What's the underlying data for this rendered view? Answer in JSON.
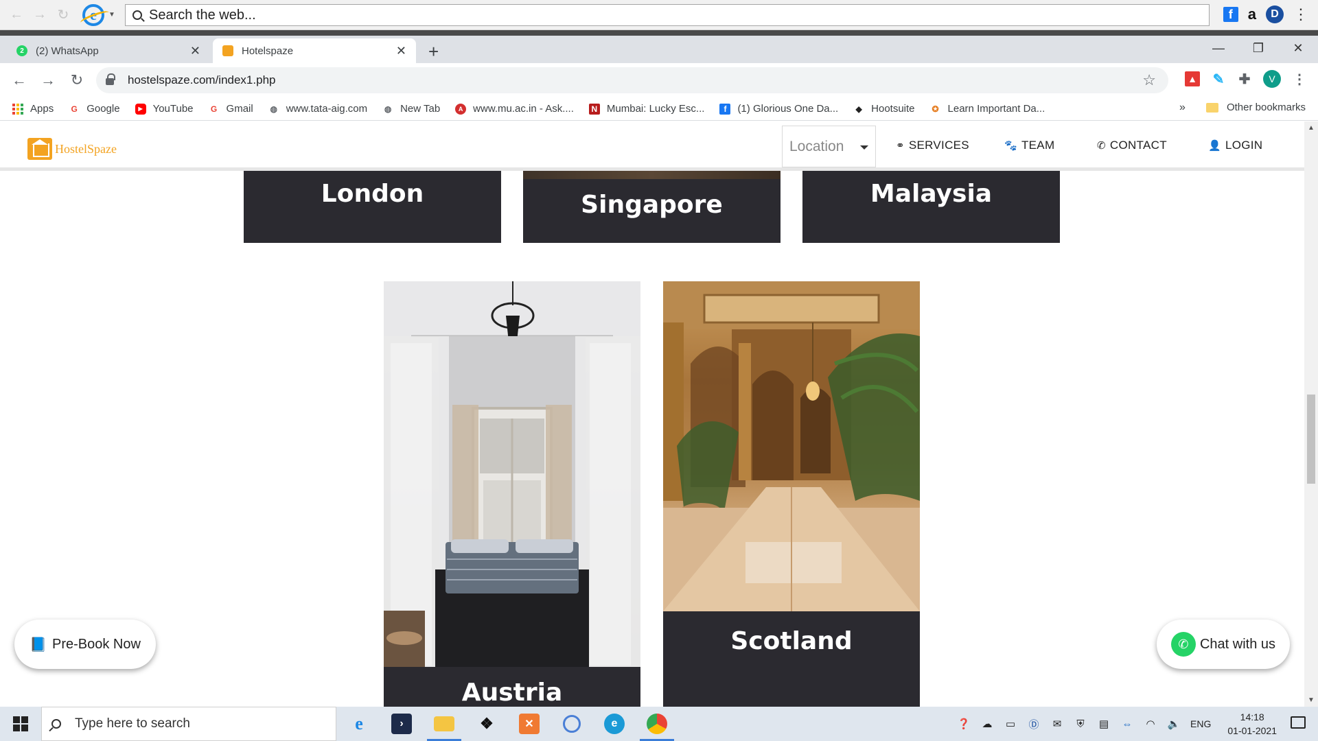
{
  "top_toolbar": {
    "search_placeholder": "Search the web...",
    "amazon_label": "a",
    "dashlane_label": "D"
  },
  "tabs": [
    {
      "label": "(2) WhatsApp",
      "badge": "2"
    },
    {
      "label": "Hotelspaze"
    }
  ],
  "address_bar": {
    "url": "hostelspaze.com/index1.php",
    "avatar_letter": "V"
  },
  "bookmarks": [
    {
      "label": "Apps",
      "icon": "apps-grid-icon"
    },
    {
      "label": "Google",
      "icon": "google-icon"
    },
    {
      "label": "YouTube",
      "icon": "youtube-icon"
    },
    {
      "label": "Gmail",
      "icon": "google-icon"
    },
    {
      "label": "www.tata-aig.com",
      "icon": "globe-icon"
    },
    {
      "label": "New Tab",
      "icon": "globe-icon"
    },
    {
      "label": "www.mu.ac.in - Ask....",
      "icon": "ask-icon"
    },
    {
      "label": "Mumbai: Lucky Esc...",
      "icon": "n-icon"
    },
    {
      "label": "(1) Glorious One Da...",
      "icon": "facebook-icon"
    },
    {
      "label": "Hootsuite",
      "icon": "hootsuite-icon"
    },
    {
      "label": "Learn Important Da...",
      "icon": "learn-icon"
    }
  ],
  "bookmarks_more": "»",
  "other_bookmarks": "Other bookmarks",
  "site": {
    "logo_text": "HostelSpaze",
    "location_placeholder": "Location",
    "nav": {
      "services": "SERVICES",
      "team": "TEAM",
      "contact": "CONTACT",
      "login": "LOGIN"
    },
    "cards": {
      "london": "London",
      "singapore": "Singapore",
      "malaysia": "Malaysia",
      "austria": "Austria",
      "scotland": "Scotland"
    },
    "prebook_label": "Pre-Book Now",
    "chat_label": "Chat with us"
  },
  "taskbar": {
    "search_placeholder": "Type here to search",
    "language": "ENG",
    "time": "14:18",
    "date": "01-01-2021"
  },
  "colors": {
    "card_bg": "#2b2a30",
    "brand_orange": "#f3a321",
    "whatsapp_green": "#25d366"
  }
}
